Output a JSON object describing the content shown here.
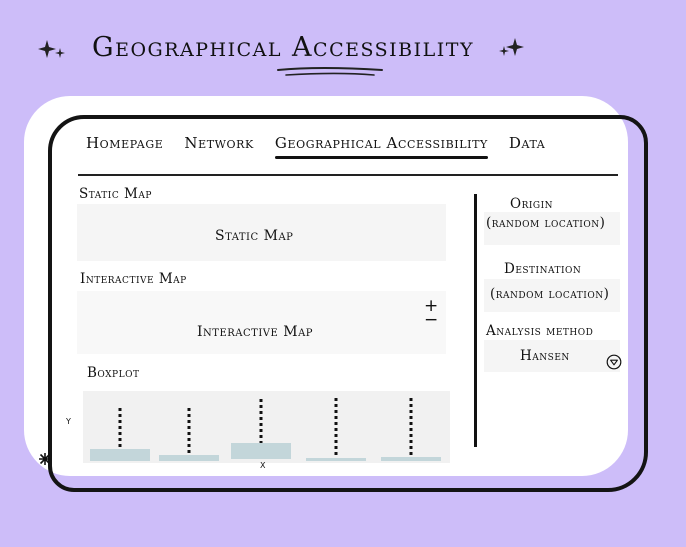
{
  "title": "Geographical Accessibility",
  "nav": {
    "items": [
      "Homepage",
      "Network",
      "Geographical Accessibility",
      "Data"
    ],
    "active_index": 2
  },
  "static_map": {
    "label": "Static Map",
    "placeholder": "Static Map"
  },
  "interactive_map": {
    "label": "Interactive Map",
    "placeholder": "Interactive Map",
    "zoom_in": "+",
    "zoom_out": "−"
  },
  "boxplot": {
    "label": "Boxplot",
    "y_label": "Y",
    "x_label": "X"
  },
  "sidebar": {
    "origin_label": "Origin",
    "origin_value": "(random location)",
    "destination_label": "Destination",
    "destination_value": "(random location)",
    "method_label": "Analysis method",
    "method_value": "Hansen"
  },
  "colors": {
    "background": "#cdbdf9",
    "card": "#ffffff",
    "panel": "#f5f5f5",
    "box_fill": "#c3d6da"
  },
  "icons": [
    "sparkle-icon",
    "dropdown-arrow-icon",
    "zoom-in-icon",
    "zoom-out-icon"
  ]
}
